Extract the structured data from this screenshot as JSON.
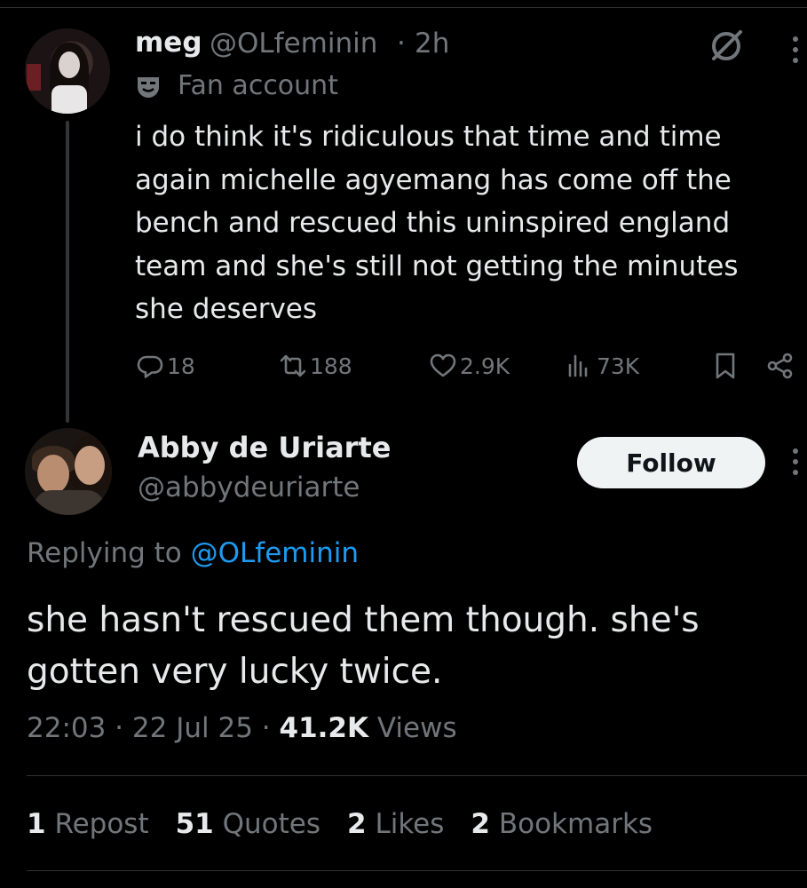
{
  "parent_tweet": {
    "author_name": "meg",
    "handle": "@OLfeminin",
    "separator": "·",
    "time": "2h",
    "label": "Fan account",
    "text": "i do think it's ridiculous that time and time again michelle agyemang has come off the bench and rescued this uninspired england team and she's still not getting the minutes she deserves",
    "actions": {
      "replies": "18",
      "reposts": "188",
      "likes": "2.9K",
      "views": "73K"
    }
  },
  "reply_tweet": {
    "author_name": "Abby de Uriarte",
    "handle": "@abbydeuriarte",
    "follow_label": "Follow",
    "replying_to_prefix": "Replying to ",
    "replying_to_handle": "@OLfeminin",
    "text": "she hasn't rescued them though. she's gotten very lucky twice.",
    "time": "22:03",
    "date": "22 Jul 25",
    "separator": "·",
    "views_count": "41.2K",
    "views_label": "Views"
  },
  "engagement": {
    "reposts_count": "1",
    "reposts_label": "Repost",
    "quotes_count": "51",
    "quotes_label": "Quotes",
    "likes_count": "2",
    "likes_label": "Likes",
    "bookmarks_count": "2",
    "bookmarks_label": "Bookmarks"
  },
  "colors": {
    "background": "#000000",
    "text": "#e7e9ea",
    "muted": "#71767b",
    "link": "#1d9bf0",
    "divider": "#2f3336"
  },
  "icons": [
    "grok-icon",
    "more-icon",
    "fan-account-mask-icon",
    "reply-icon",
    "repost-icon",
    "like-icon",
    "views-icon",
    "bookmark-icon",
    "share-icon"
  ]
}
